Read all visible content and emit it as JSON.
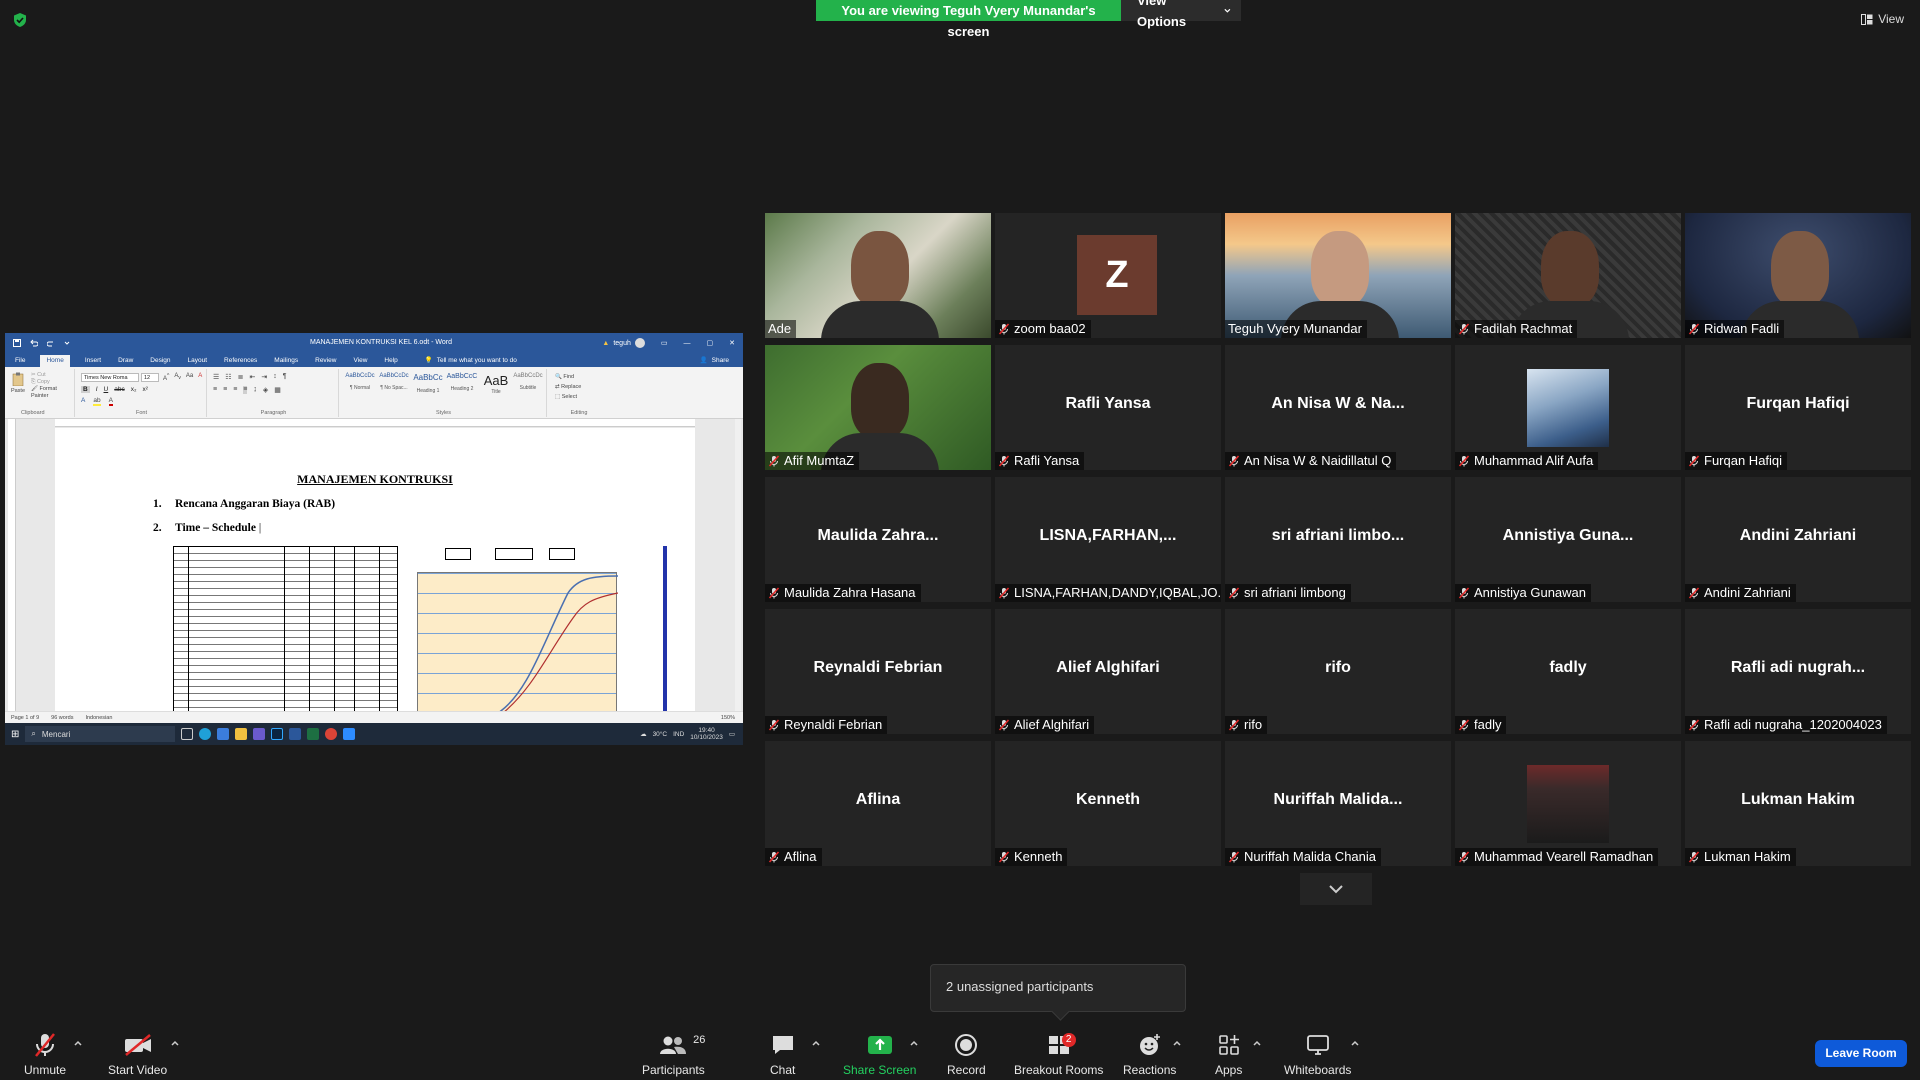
{
  "banner": {
    "message": "You are viewing Teguh Vyery Munandar's screen",
    "view_options": "View Options"
  },
  "view_button": "View",
  "word": {
    "doc_title": "MANAJEMEN KONTRUKSI KEL 6.odt  -  Word",
    "user": "teguh",
    "tabs": [
      "File",
      "Home",
      "Insert",
      "Draw",
      "Design",
      "Layout",
      "References",
      "Mailings",
      "Review",
      "View",
      "Help"
    ],
    "tell_me": "Tell me what you want to do",
    "share": "Share",
    "font_name": "Times New Roma",
    "font_size": "12",
    "groups": {
      "clipboard": "Clipboard",
      "font": "Font",
      "paragraph": "Paragraph",
      "styles": "Styles",
      "editing": "Editing"
    },
    "clipboard": {
      "paste": "Paste",
      "cut": "Cut",
      "copy": "Copy",
      "format_painter": "Format Painter"
    },
    "styles": [
      {
        "sample": "AaBbCcDc",
        "name": "¶ Normal"
      },
      {
        "sample": "AaBbCcDc",
        "name": "¶ No Spac..."
      },
      {
        "sample": "AaBbCc",
        "name": "Heading 1"
      },
      {
        "sample": "AaBbCcC",
        "name": "Heading 2"
      },
      {
        "sample": "AaB",
        "name": "Title"
      },
      {
        "sample": "AaBbCcDc",
        "name": "Subtitle"
      }
    ],
    "editing": {
      "find": "Find",
      "replace": "Replace",
      "select": "Select"
    },
    "page_title": "MANAJEMEN KONTRUKSI",
    "list": [
      {
        "num": "1.",
        "text": "Rencana Anggaran Biaya (RAB)"
      },
      {
        "num": "2.",
        "text": "Time – Schedule"
      }
    ],
    "status": {
      "page": "Page 1 of 9",
      "words": "96 words",
      "lang": "Indonesian",
      "zoom": "150%"
    },
    "taskbar": {
      "search": "Mencari",
      "temp": "30°C",
      "lang": "IND",
      "time": "19:40",
      "date": "10/10/2023"
    }
  },
  "participants": [
    {
      "name": "Ade",
      "muted": false,
      "kind": "video"
    },
    {
      "name": "zoom baa02",
      "muted": true,
      "kind": "avatar",
      "initial": "Z"
    },
    {
      "name": "Teguh Vyery Munandar",
      "muted": false,
      "kind": "video",
      "active": true
    },
    {
      "name": "Fadilah Rachmat",
      "muted": true,
      "kind": "video"
    },
    {
      "name": "Ridwan Fadli",
      "muted": true,
      "kind": "video"
    },
    {
      "name": "Afif MumtaZ",
      "muted": true,
      "kind": "video"
    },
    {
      "name": "Rafli Yansa",
      "display": "Rafli Yansa",
      "muted": true,
      "kind": "name"
    },
    {
      "name": "An Nisa W & Naidillatul Q",
      "display": "An Nisa W & Na...",
      "muted": true,
      "kind": "name"
    },
    {
      "name": "Muhammad Alif Aufa",
      "muted": true,
      "kind": "picture"
    },
    {
      "name": "Furqan Hafiqi",
      "display": "Furqan Hafiqi",
      "muted": true,
      "kind": "name"
    },
    {
      "name": "Maulida Zahra Hasana",
      "display": "Maulida  Zahra...",
      "muted": true,
      "kind": "name"
    },
    {
      "name": "LISNA,FARHAN,DANDY,IQBAL,JO...",
      "display": "LISNA,FARHAN,...",
      "muted": true,
      "kind": "name"
    },
    {
      "name": "sri afriani limbong",
      "display": "sri  afriani  limbo...",
      "muted": true,
      "kind": "name"
    },
    {
      "name": "Annistiya Gunawan",
      "display": "Annistiya  Guna...",
      "muted": true,
      "kind": "name"
    },
    {
      "name": "Andini Zahriani",
      "display": "Andini Zahriani",
      "muted": true,
      "kind": "name"
    },
    {
      "name": "Reynaldi Febrian",
      "display": "Reynaldi Febrian",
      "muted": true,
      "kind": "name"
    },
    {
      "name": "Alief Alghifari",
      "display": "Alief Alghifari",
      "muted": true,
      "kind": "name"
    },
    {
      "name": "rifo",
      "display": "rifo",
      "muted": true,
      "kind": "name"
    },
    {
      "name": "fadly",
      "display": "fadly",
      "muted": true,
      "kind": "name"
    },
    {
      "name": "Rafli adi nugraha_1202004023",
      "display": "Rafli adi nugrah...",
      "muted": true,
      "kind": "name"
    },
    {
      "name": "Aflina",
      "display": "Aflina",
      "muted": true,
      "kind": "name"
    },
    {
      "name": "Kenneth",
      "display": "Kenneth",
      "muted": true,
      "kind": "name"
    },
    {
      "name": "Nuriffah Malida Chania",
      "display": "Nuriffah  Malida...",
      "muted": true,
      "kind": "name"
    },
    {
      "name": "Muhammad Vearell Ramadhan",
      "muted": true,
      "kind": "picture2"
    },
    {
      "name": "Lukman Hakim",
      "display": "Lukman Hakim",
      "muted": true,
      "kind": "name"
    }
  ],
  "toast": "2 unassigned participants",
  "toolbar": {
    "unmute": "Unmute",
    "start_video": "Start Video",
    "participants": "Participants",
    "participants_count": "26",
    "chat": "Chat",
    "share_screen": "Share Screen",
    "record": "Record",
    "breakout_rooms": "Breakout Rooms",
    "breakout_badge": "2",
    "reactions": "Reactions",
    "apps": "Apps",
    "whiteboards": "Whiteboards",
    "leave": "Leave Room"
  },
  "colors": {
    "accent_green": "#23b24b",
    "active_speaker": "#e4e44b",
    "leave_blue": "#0e5ad9",
    "word_blue": "#2b579a"
  }
}
